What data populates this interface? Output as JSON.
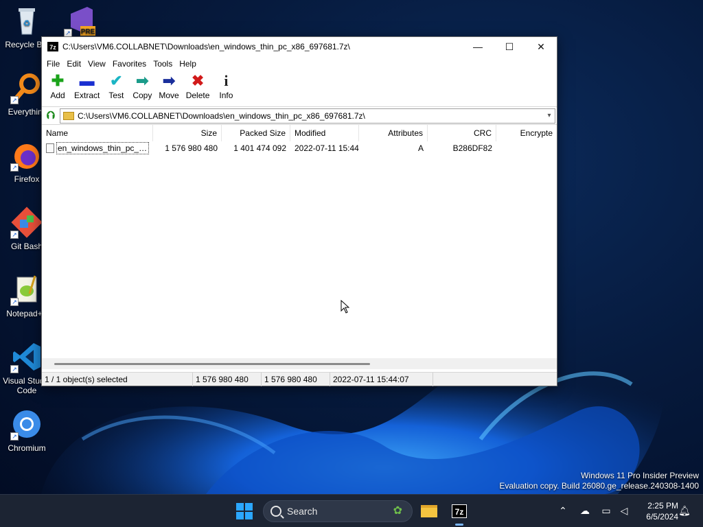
{
  "desktop": {
    "icons": [
      {
        "label": "Recycle Bin",
        "icon": "recycle-bin-icon"
      },
      {
        "label": "",
        "icon": "visual-studio-preview-icon",
        "badge": "PRE"
      },
      {
        "label": "Everything",
        "icon": "everything-search-icon"
      },
      {
        "label": "Firefox",
        "icon": "firefox-icon"
      },
      {
        "label": "Git Bash",
        "icon": "git-bash-icon"
      },
      {
        "label": "Notepad++",
        "icon": "notepad-plus-plus-icon"
      },
      {
        "label": "Visual Studio Code",
        "icon": "vscode-icon"
      },
      {
        "label": "Chromium",
        "icon": "chromium-icon"
      }
    ]
  },
  "window": {
    "app_icon": "7z",
    "title": "C:\\Users\\VM6.COLLABNET\\Downloads\\en_windows_thin_pc_x86_697681.7z\\",
    "controls": {
      "minimize": "—",
      "maximize": "☐",
      "close": "✕"
    },
    "menu": [
      "File",
      "Edit",
      "View",
      "Favorites",
      "Tools",
      "Help"
    ],
    "toolbar": [
      {
        "label": "Add",
        "icon": "plus-icon",
        "glyph": "✚",
        "color": "#1aa31a"
      },
      {
        "label": "Extract",
        "icon": "minus-icon",
        "glyph": "▬",
        "color": "#1a2fd1"
      },
      {
        "label": "Test",
        "icon": "check-icon",
        "glyph": "✔",
        "color": "#1bb5c4"
      },
      {
        "label": "Copy",
        "icon": "copy-arrow-icon",
        "glyph": "➡",
        "color": "#1a9b8a"
      },
      {
        "label": "Move",
        "icon": "move-arrow-icon",
        "glyph": "➡",
        "color": "#1a2f9b"
      },
      {
        "label": "Delete",
        "icon": "delete-x-icon",
        "glyph": "✖",
        "color": "#d11a1a"
      },
      {
        "label": "Info",
        "icon": "info-icon",
        "glyph": "i",
        "color": "#222222"
      }
    ],
    "address": "C:\\Users\\VM6.COLLABNET\\Downloads\\en_windows_thin_pc_x86_697681.7z\\",
    "columns": [
      "Name",
      "Size",
      "Packed Size",
      "Modified",
      "Attributes",
      "CRC",
      "Encrypte"
    ],
    "rows": [
      {
        "name": "en_windows_thin_pc_x8...",
        "size": "1 576 980 480",
        "packed": "1 401 474 092",
        "modified": "2022-07-11 15:44",
        "attributes": "A",
        "crc": "B286DF82",
        "encrypted": ""
      }
    ],
    "status": {
      "selection": "1 / 1 object(s) selected",
      "size": "1 576 980 480",
      "packed": "1 576 980 480",
      "modified": "2022-07-11 15:44:07"
    }
  },
  "watermark": {
    "line1": "Windows 11 Pro Insider Preview",
    "line2": "Evaluation copy. Build 26080.ge_release.240308-1400"
  },
  "taskbar": {
    "search_label": "Search",
    "clock_time": "2:25 PM",
    "clock_date": "6/5/2024",
    "tray_icons": [
      "chevron-up-icon",
      "cloud-off-icon",
      "network-icon",
      "volume-icon",
      "notification-bell-icon"
    ]
  }
}
